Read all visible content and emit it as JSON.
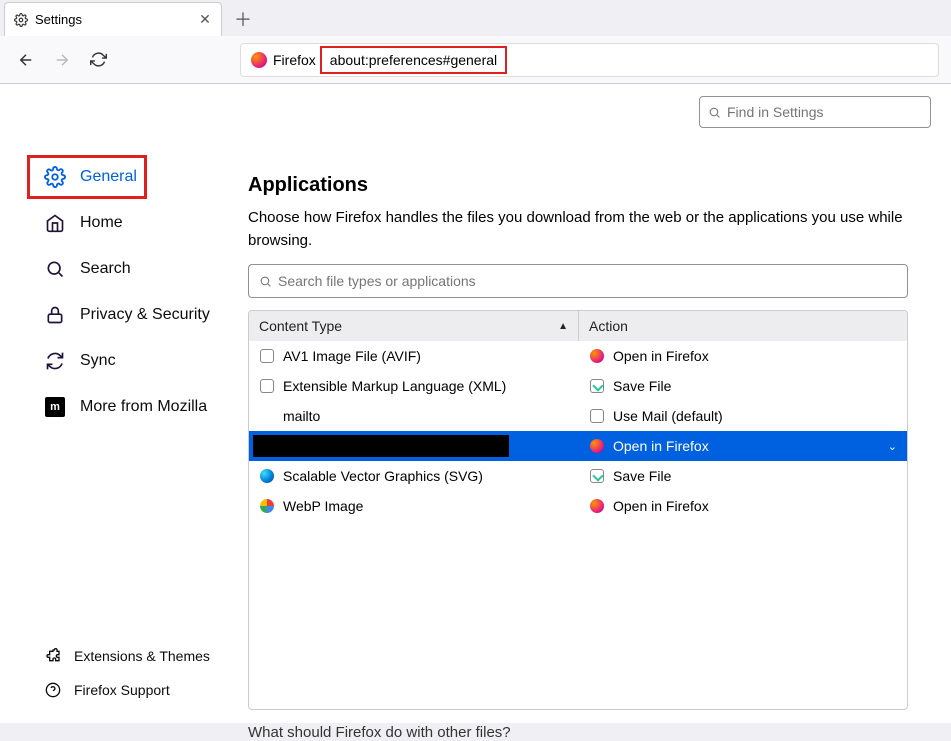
{
  "tab": {
    "title": "Settings"
  },
  "url": {
    "identity": "Firefox",
    "value": "about:preferences#general"
  },
  "find": {
    "placeholder": "Find in Settings"
  },
  "sidebar": {
    "items": [
      {
        "label": "General"
      },
      {
        "label": "Home"
      },
      {
        "label": "Search"
      },
      {
        "label": "Privacy & Security"
      },
      {
        "label": "Sync"
      },
      {
        "label": "More from Mozilla"
      }
    ],
    "footer": [
      {
        "label": "Extensions & Themes"
      },
      {
        "label": "Firefox Support"
      }
    ]
  },
  "section": {
    "heading": "Applications",
    "description": "Choose how Firefox handles the files you download from the web or the applications you use while browsing.",
    "search_placeholder": "Search file types or applications",
    "cols": {
      "ct": "Content Type",
      "ac": "Action"
    },
    "rows": [
      {
        "ct": "AV1 Image File (AVIF)",
        "ac": "Open in Firefox",
        "cticon": "file",
        "acicon": "ff"
      },
      {
        "ct": "Extensible Markup Language (XML)",
        "ac": "Save File",
        "cticon": "file",
        "acicon": "save"
      },
      {
        "ct": "mailto",
        "ac": "Use Mail (default)",
        "cticon": "",
        "acicon": "mail"
      },
      {
        "ct": "",
        "ac": "Open in Firefox",
        "cticon": "",
        "acicon": "ff",
        "selected": true
      },
      {
        "ct": "Scalable Vector Graphics (SVG)",
        "ac": "Save File",
        "cticon": "edge",
        "acicon": "save"
      },
      {
        "ct": "WebP Image",
        "ac": "Open in Firefox",
        "cticon": "webp",
        "acicon": "ff"
      }
    ],
    "after": "What should Firefox do with other files?"
  }
}
